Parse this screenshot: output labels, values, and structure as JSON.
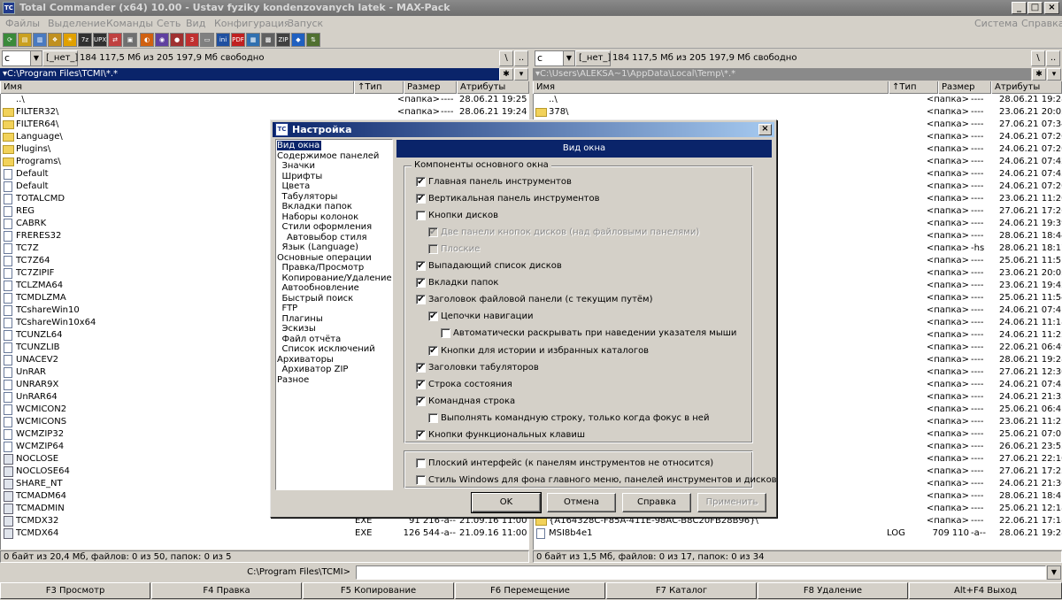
{
  "window": {
    "title": "Total Commander (x64) 10.00 - Ustav fyziky kondenzovanych latek - MAX-Pack",
    "icon_label": "TC",
    "controls": [
      "_",
      "□",
      "×"
    ]
  },
  "menubar": {
    "left": [
      "Файлы",
      "Выделение",
      "Команды",
      "Сеть",
      "Вид",
      "Конфигурация",
      "Запуск"
    ],
    "right": [
      "Система",
      "Справка"
    ]
  },
  "toolbar": {
    "icons": [
      {
        "name": "refresh-icon",
        "glyph": "⟳",
        "color": "#3a8a3a"
      },
      {
        "name": "brief-view-icon",
        "glyph": "▤",
        "color": "#caa020"
      },
      {
        "name": "full-view-icon",
        "glyph": "▥",
        "color": "#4a7ac0"
      },
      {
        "name": "tree-icon",
        "glyph": "❖",
        "color": "#c09020"
      },
      {
        "name": "sun-icon",
        "glyph": "☀",
        "color": "#e0a000"
      },
      {
        "name": "pack-7z-icon",
        "glyph": "7z",
        "color": "#303030"
      },
      {
        "name": "upx-icon",
        "glyph": "UPX",
        "color": "#303030"
      },
      {
        "name": "reverse-icon",
        "glyph": "⇄",
        "color": "#c04040"
      },
      {
        "name": "compare-icon",
        "glyph": "▣",
        "color": "#707070"
      },
      {
        "name": "paint-icon",
        "glyph": "◐",
        "color": "#d06010"
      },
      {
        "name": "disk-icon",
        "glyph": "◉",
        "color": "#6040a0"
      },
      {
        "name": "media-icon",
        "glyph": "●",
        "color": "#a03030"
      },
      {
        "name": "script-icon",
        "glyph": "3",
        "color": "#c03030"
      },
      {
        "name": "window-icon",
        "glyph": "▭",
        "color": "#808080"
      },
      {
        "name": "ini-icon",
        "glyph": "ini",
        "color": "#2050a0"
      },
      {
        "name": "pdf-icon",
        "glyph": "PDF",
        "color": "#c02020"
      },
      {
        "name": "grid-icon",
        "glyph": "▦",
        "color": "#3070b0"
      },
      {
        "name": "calc-icon",
        "glyph": "▩",
        "color": "#606060"
      },
      {
        "name": "zip-icon",
        "glyph": "ZIP",
        "color": "#404040"
      },
      {
        "name": "html-icon",
        "glyph": "◆",
        "color": "#2060c0"
      },
      {
        "name": "sort-icon",
        "glyph": "⇅",
        "color": "#507030"
      }
    ]
  },
  "left_panel": {
    "drive": "c",
    "volume": "[_нет_]",
    "free": "184 117,5 Мб из 205 197,9 Мб свободно",
    "path": "▾C:\\Program Files\\TCMI\\*.*",
    "columns": {
      "name": "Имя",
      "type": "↑Тип",
      "size": "Размер",
      "attrs": "Атрибуты"
    },
    "files": [
      {
        "icon": "up",
        "name": "..\\",
        "ext": "",
        "size": "<папка>",
        "date": "28.06.21 19:25",
        "attr": "----"
      },
      {
        "icon": "folder",
        "name": "FILTER32\\",
        "ext": "",
        "size": "<папка>",
        "date": "28.06.21 19:24",
        "attr": "----"
      },
      {
        "icon": "folder",
        "name": "FILTER64\\",
        "ext": "",
        "size": "",
        "date": "",
        "attr": ""
      },
      {
        "icon": "folder",
        "name": "Language\\",
        "ext": "",
        "size": "",
        "date": "",
        "attr": ""
      },
      {
        "icon": "folder",
        "name": "Plugins\\",
        "ext": "",
        "size": "",
        "date": "",
        "attr": ""
      },
      {
        "icon": "folder",
        "name": "Programs\\",
        "ext": "",
        "size": "",
        "date": "",
        "attr": ""
      },
      {
        "icon": "doc",
        "name": "Default",
        "ext": "",
        "size": "",
        "date": "",
        "attr": ""
      },
      {
        "icon": "doc",
        "name": "Default",
        "ext": "",
        "size": "",
        "date": "",
        "attr": ""
      },
      {
        "icon": "doc",
        "name": "TOTALCMD",
        "ext": "",
        "size": "",
        "date": "",
        "attr": ""
      },
      {
        "icon": "doc",
        "name": "REG",
        "ext": "",
        "size": "",
        "date": "",
        "attr": ""
      },
      {
        "icon": "doc",
        "name": "CABRK",
        "ext": "",
        "size": "",
        "date": "",
        "attr": ""
      },
      {
        "icon": "doc",
        "name": "FRERES32",
        "ext": "",
        "size": "",
        "date": "",
        "attr": ""
      },
      {
        "icon": "doc",
        "name": "TC7Z",
        "ext": "",
        "size": "",
        "date": "",
        "attr": ""
      },
      {
        "icon": "doc",
        "name": "TC7Z64",
        "ext": "",
        "size": "",
        "date": "",
        "attr": ""
      },
      {
        "icon": "doc",
        "name": "TC7ZIPIF",
        "ext": "",
        "size": "",
        "date": "",
        "attr": ""
      },
      {
        "icon": "doc",
        "name": "TCLZMA64",
        "ext": "",
        "size": "",
        "date": "",
        "attr": ""
      },
      {
        "icon": "doc",
        "name": "TCMDLZMA",
        "ext": "",
        "size": "",
        "date": "",
        "attr": ""
      },
      {
        "icon": "doc",
        "name": "TCshareWin10",
        "ext": "",
        "size": "",
        "date": "",
        "attr": ""
      },
      {
        "icon": "doc",
        "name": "TCshareWin10x64",
        "ext": "",
        "size": "",
        "date": "",
        "attr": ""
      },
      {
        "icon": "doc",
        "name": "TCUNZL64",
        "ext": "",
        "size": "",
        "date": "",
        "attr": ""
      },
      {
        "icon": "doc",
        "name": "TCUNZLIB",
        "ext": "",
        "size": "",
        "date": "",
        "attr": ""
      },
      {
        "icon": "doc",
        "name": "UNACEV2",
        "ext": "",
        "size": "",
        "date": "",
        "attr": ""
      },
      {
        "icon": "doc",
        "name": "UnRAR",
        "ext": "",
        "size": "",
        "date": "",
        "attr": ""
      },
      {
        "icon": "doc",
        "name": "UNRAR9X",
        "ext": "",
        "size": "",
        "date": "",
        "attr": ""
      },
      {
        "icon": "doc",
        "name": "UnRAR64",
        "ext": "",
        "size": "",
        "date": "",
        "attr": ""
      },
      {
        "icon": "doc",
        "name": "WCMICON2",
        "ext": "",
        "size": "",
        "date": "",
        "attr": ""
      },
      {
        "icon": "doc",
        "name": "WCMICONS",
        "ext": "",
        "size": "",
        "date": "",
        "attr": ""
      },
      {
        "icon": "doc",
        "name": "WCMZIP32",
        "ext": "",
        "size": "",
        "date": "",
        "attr": ""
      },
      {
        "icon": "doc",
        "name": "WCMZIP64",
        "ext": "",
        "size": "",
        "date": "",
        "attr": ""
      },
      {
        "icon": "exe",
        "name": "NOCLOSE",
        "ext": "",
        "size": "",
        "date": "",
        "attr": ""
      },
      {
        "icon": "exe",
        "name": "NOCLOSE64",
        "ext": "",
        "size": "",
        "date": "",
        "attr": ""
      },
      {
        "icon": "exe",
        "name": "SHARE_NT",
        "ext": "",
        "size": "",
        "date": "",
        "attr": ""
      },
      {
        "icon": "exe",
        "name": "TCMADM64",
        "ext": "",
        "size": "",
        "date": "",
        "attr": ""
      },
      {
        "icon": "exe",
        "name": "TCMADMIN",
        "ext": "",
        "size": "",
        "date": "",
        "attr": ""
      },
      {
        "icon": "exe",
        "name": "TCMDX32",
        "ext": "EXE",
        "size": "91 216",
        "date": "21.09.16 11:00",
        "attr": "-a--"
      },
      {
        "icon": "exe",
        "name": "TCMDX64",
        "ext": "EXE",
        "size": "126 544",
        "date": "21.09.16 11:00",
        "attr": "-a--"
      }
    ],
    "status": "0 байт из 20,4 Мб, файлов: 0 из 50, папок: 0 из 5"
  },
  "right_panel": {
    "drive": "c",
    "volume": "[_нет_]",
    "free": "184 117,5 Мб из 205 197,9 Мб свободно",
    "path": "▾C:\\Users\\ALEKSA~1\\AppData\\Local\\Temp\\*.*",
    "columns": {
      "name": "Имя",
      "type": "↑Тип",
      "size": "Размер",
      "attrs": "Атрибуты"
    },
    "files": [
      {
        "icon": "up",
        "name": "..\\",
        "ext": "",
        "size": "<папка>",
        "date": "28.06.21 19:28",
        "attr": "----"
      },
      {
        "icon": "folder",
        "name": "378\\",
        "ext": "",
        "size": "<папка>",
        "date": "23.06.21 20:03",
        "attr": "----"
      },
      {
        "icon": "folder",
        "name": "",
        "ext": "",
        "size": "<папка>",
        "date": "27.06.21 07:34",
        "attr": "----"
      },
      {
        "icon": "folder",
        "name": "",
        "ext": "",
        "size": "<папка>",
        "date": "24.06.21 07:20",
        "attr": "----"
      },
      {
        "icon": "folder",
        "name": "",
        "ext": "",
        "size": "<папка>",
        "date": "24.06.21 07:20",
        "attr": "----"
      },
      {
        "icon": "folder",
        "name": "",
        "ext": "",
        "size": "<папка>",
        "date": "24.06.21 07:42",
        "attr": "----"
      },
      {
        "icon": "folder",
        "name": "",
        "ext": "",
        "size": "<папка>",
        "date": "24.06.21 07:43",
        "attr": "----"
      },
      {
        "icon": "folder",
        "name": "",
        "ext": "",
        "size": "<папка>",
        "date": "24.06.21 07:20",
        "attr": "----"
      },
      {
        "icon": "folder",
        "name": "",
        "ext": "",
        "size": "<папка>",
        "date": "23.06.21 11:20",
        "attr": "----"
      },
      {
        "icon": "folder",
        "name": "",
        "ext": "",
        "size": "<папка>",
        "date": "27.06.21 17:26",
        "attr": "----"
      },
      {
        "icon": "folder",
        "name": "",
        "ext": "",
        "size": "<папка>",
        "date": "24.06.21 19:39",
        "attr": "----"
      },
      {
        "icon": "folder",
        "name": "",
        "ext": "",
        "size": "<папка>",
        "date": "28.06.21 18:44",
        "attr": "----"
      },
      {
        "icon": "folder",
        "name": "",
        "ext": "",
        "size": "<папка>",
        "date": "28.06.21 18:17",
        "attr": "-hs"
      },
      {
        "icon": "folder",
        "name": "",
        "ext": "",
        "size": "<папка>",
        "date": "25.06.21 11:51",
        "attr": "----"
      },
      {
        "icon": "folder",
        "name": "",
        "ext": "",
        "size": "<папка>",
        "date": "23.06.21 20:03",
        "attr": "----"
      },
      {
        "icon": "folder",
        "name": "",
        "ext": "",
        "size": "<папка>",
        "date": "23.06.21 19:42",
        "attr": "----"
      },
      {
        "icon": "folder",
        "name": "",
        "ext": "",
        "size": "<папка>",
        "date": "25.06.21 11:54",
        "attr": "----"
      },
      {
        "icon": "folder",
        "name": "",
        "ext": "",
        "size": "<папка>",
        "date": "24.06.21 07:41",
        "attr": "----"
      },
      {
        "icon": "folder",
        "name": "",
        "ext": "",
        "size": "<папка>",
        "date": "24.06.21 11:18",
        "attr": "----"
      },
      {
        "icon": "folder",
        "name": "",
        "ext": "",
        "size": "<папка>",
        "date": "24.06.21 11:22",
        "attr": "----"
      },
      {
        "icon": "folder",
        "name": "",
        "ext": "",
        "size": "<папка>",
        "date": "22.06.21 06:49",
        "attr": "----"
      },
      {
        "icon": "folder",
        "name": "",
        "ext": "",
        "size": "<папка>",
        "date": "28.06.21 19:28",
        "attr": "----"
      },
      {
        "icon": "folder",
        "name": "",
        "ext": "",
        "size": "<папка>",
        "date": "27.06.21 12:30",
        "attr": "----"
      },
      {
        "icon": "folder",
        "name": "",
        "ext": "",
        "size": "<папка>",
        "date": "24.06.21 07:43",
        "attr": "----"
      },
      {
        "icon": "folder",
        "name": "",
        "ext": "",
        "size": "<папка>",
        "date": "24.06.21 21:32",
        "attr": "----"
      },
      {
        "icon": "folder",
        "name": "",
        "ext": "",
        "size": "<папка>",
        "date": "25.06.21 06:41",
        "attr": "----"
      },
      {
        "icon": "folder",
        "name": "",
        "ext": "",
        "size": "<папка>",
        "date": "23.06.21 11:23",
        "attr": "----"
      },
      {
        "icon": "folder",
        "name": "",
        "ext": "",
        "size": "<папка>",
        "date": "25.06.21 07:01",
        "attr": "----"
      },
      {
        "icon": "folder",
        "name": "",
        "ext": "",
        "size": "<папка>",
        "date": "26.06.21 23:53",
        "attr": "----"
      },
      {
        "icon": "folder",
        "name": "",
        "ext": "",
        "size": "<папка>",
        "date": "27.06.21 22:10",
        "attr": "----"
      },
      {
        "icon": "folder",
        "name": "",
        "ext": "",
        "size": "<папка>",
        "date": "27.06.21 17:25",
        "attr": "----"
      },
      {
        "icon": "folder",
        "name": "",
        "ext": "",
        "size": "<папка>",
        "date": "24.06.21 21:30",
        "attr": "----"
      },
      {
        "icon": "folder",
        "name": "",
        "ext": "",
        "size": "<папка>",
        "date": "28.06.21 18:47",
        "attr": "----"
      },
      {
        "icon": "folder",
        "name": "",
        "ext": "",
        "size": "<папка>",
        "date": "25.06.21 12:18",
        "attr": "----"
      },
      {
        "icon": "folder",
        "name": "{A164328C-F85A-411E-98AC-B8C20FB28B96}\\",
        "ext": "",
        "size": "<папка>",
        "date": "22.06.21 17:18",
        "attr": "----"
      },
      {
        "icon": "doc",
        "name": "MSI8b4e1",
        "ext": "LOG",
        "size": "709 110",
        "date": "28.06.21 19:28",
        "attr": "-a--"
      }
    ],
    "status": "0 байт из 1,5 Мб, файлов: 0 из 17, папок: 0 из 34"
  },
  "cmdline": {
    "label": "C:\\Program Files\\TCMI>",
    "value": ""
  },
  "fkeys": [
    "F3 Просмотр",
    "F4 Правка",
    "F5 Копирование",
    "F6 Перемещение",
    "F7 Каталог",
    "F8 Удаление",
    "Alt+F4 Выход"
  ],
  "dialog": {
    "title": "Настройка",
    "page_title": "Вид окна",
    "tree": [
      {
        "label": "Вид окна",
        "indent": 0,
        "selected": true
      },
      {
        "label": "Содержимое панелей",
        "indent": 0
      },
      {
        "label": "Значки",
        "indent": 1
      },
      {
        "label": "Шрифты",
        "indent": 1
      },
      {
        "label": "Цвета",
        "indent": 1
      },
      {
        "label": "Табуляторы",
        "indent": 1
      },
      {
        "label": "Вкладки папок",
        "indent": 1
      },
      {
        "label": "Наборы колонок",
        "indent": 1
      },
      {
        "label": "Стили оформления",
        "indent": 1
      },
      {
        "label": "Автовыбор стиля",
        "indent": 2
      },
      {
        "label": "Язык (Language)",
        "indent": 1
      },
      {
        "label": "Основные операции",
        "indent": 0
      },
      {
        "label": "Правка/Просмотр",
        "indent": 1
      },
      {
        "label": "Копирование/Удаление",
        "indent": 1
      },
      {
        "label": "Автообновление",
        "indent": 1
      },
      {
        "label": "Быстрый поиск",
        "indent": 1
      },
      {
        "label": "FTP",
        "indent": 1
      },
      {
        "label": "Плагины",
        "indent": 1
      },
      {
        "label": "Эскизы",
        "indent": 1
      },
      {
        "label": "Файл отчёта",
        "indent": 1
      },
      {
        "label": "Список исключений",
        "indent": 1
      },
      {
        "label": "Архиваторы",
        "indent": 0
      },
      {
        "label": "Архиватор ZIP",
        "indent": 1
      },
      {
        "label": "Разное",
        "indent": 0
      }
    ],
    "group_title": "Компоненты основного окна",
    "options": [
      {
        "label": "Главная панель инструментов",
        "checked": true,
        "indent": 0,
        "enabled": true
      },
      {
        "label": "Вертикальная панель инструментов",
        "checked": true,
        "indent": 0,
        "enabled": true
      },
      {
        "label": "Кнопки дисков",
        "checked": false,
        "indent": 0,
        "enabled": true
      },
      {
        "label": "Две панели кнопок дисков (над файловыми панелями)",
        "checked": true,
        "indent": 1,
        "enabled": false
      },
      {
        "label": "Плоские",
        "checked": false,
        "indent": 1,
        "enabled": false
      },
      {
        "label": "Выпадающий список дисков",
        "checked": true,
        "indent": 0,
        "enabled": true
      },
      {
        "label": "Вкладки папок",
        "checked": true,
        "indent": 0,
        "enabled": true
      },
      {
        "label": "Заголовок файловой панели (с текущим путём)",
        "checked": true,
        "indent": 0,
        "enabled": true
      },
      {
        "label": "Цепочки навигации",
        "checked": true,
        "indent": 1,
        "enabled": true
      },
      {
        "label": "Автоматически раскрывать при наведении указателя мыши",
        "checked": false,
        "indent": 2,
        "enabled": true
      },
      {
        "label": "Кнопки для истории и избранных каталогов",
        "checked": true,
        "indent": 1,
        "enabled": true
      },
      {
        "label": "Заголовки табуляторов",
        "checked": true,
        "indent": 0,
        "enabled": true
      },
      {
        "label": "Строка состояния",
        "checked": true,
        "indent": 0,
        "enabled": true
      },
      {
        "label": "Командная строка",
        "checked": true,
        "indent": 0,
        "enabled": true
      },
      {
        "label": "Выполнять командную строку, только когда фокус в ней",
        "checked": false,
        "indent": 1,
        "enabled": true
      },
      {
        "label": "Кнопки функциональных клавиш",
        "checked": true,
        "indent": 0,
        "enabled": true
      }
    ],
    "extra_options": [
      {
        "label": "Плоский интерфейс (к панелям инструментов не относится)",
        "checked": false
      },
      {
        "label": "Стиль Windows для фона главного меню, панелей инструментов и дисков",
        "checked": false
      }
    ],
    "buttons": {
      "ok": "OK",
      "cancel": "Отмена",
      "help": "Справка",
      "apply": "Применить"
    }
  },
  "colors": {
    "selection": "#0a246a",
    "path_active": "#0a246a",
    "path_inactive": "#8a8a8a",
    "folder": "#f2d25a"
  }
}
